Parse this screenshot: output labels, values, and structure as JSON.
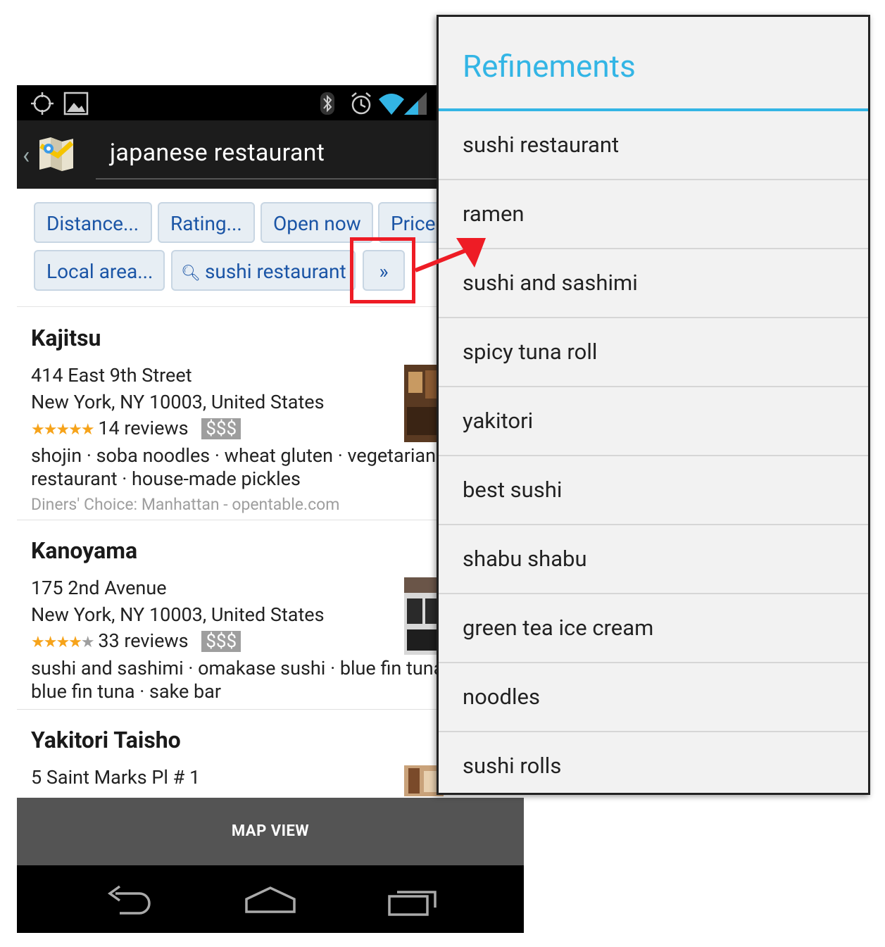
{
  "search": {
    "query": "japanese restaurant"
  },
  "chips": {
    "distance": "Distance...",
    "rating": "Rating...",
    "open_now": "Open now",
    "price": "Price",
    "local_area": "Local area...",
    "sushi": "sushi restaurant",
    "more": "»"
  },
  "results": [
    {
      "name": "Kajitsu",
      "address1": "414 East 9th Street",
      "address2": "New York, NY 10003, United States",
      "rating": 5,
      "reviews": "14 reviews",
      "price": "$$$",
      "tags1": "shojin · soba noodles · wheat gluten · vegetarian",
      "tags2": "restaurant · house-made pickles",
      "source": "Diners' Choice: Manhattan - opentable.com"
    },
    {
      "name": "Kanoyama",
      "address1": "175 2nd Avenue",
      "address2": "New York, NY 10003, United States",
      "rating": 4,
      "reviews": "33 reviews",
      "price": "$$$",
      "tags1": "sushi and sashimi · omakase sushi · blue fin tuna",
      "tags2": "blue fin tuna · sake bar"
    },
    {
      "name": "Yakitori Taisho",
      "address1": "5 Saint Marks Pl # 1"
    }
  ],
  "bottom": {
    "map_view": "MAP VIEW"
  },
  "refinements": {
    "title": "Refinements",
    "items": [
      "sushi restaurant",
      "ramen",
      "sushi and sashimi",
      "spicy tuna roll",
      "yakitori",
      "best sushi",
      "shabu shabu",
      "green tea ice cream",
      "noodles",
      "sushi rolls"
    ]
  },
  "colors": {
    "accent": "#33b5e5",
    "highlight": "#ee1c25",
    "chip_text": "#1b55a6",
    "star": "#f6a31a"
  },
  "icons": [
    "gps-icon",
    "gallery-icon",
    "bluetooth-icon",
    "alarm-icon",
    "wifi-icon",
    "signal-icon",
    "back-icon",
    "home-icon",
    "recents-icon",
    "search-icon",
    "maps-logo-icon"
  ]
}
